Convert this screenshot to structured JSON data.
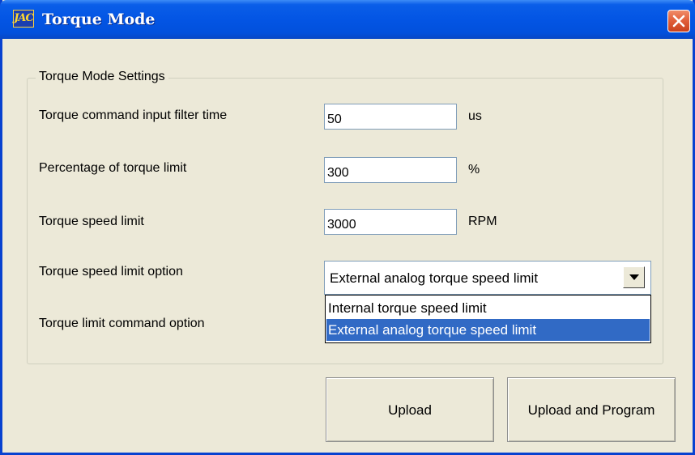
{
  "window": {
    "title": "Torque Mode",
    "icon_text": "JAC",
    "accent_color": "#0355e4",
    "close_color": "#e2613c"
  },
  "group": {
    "legend": "Torque Mode Settings"
  },
  "fields": {
    "filter_time": {
      "label": "Torque command input filter time",
      "value": "50",
      "unit": "us"
    },
    "torque_limit_pct": {
      "label": "Percentage of torque limit",
      "value": "300",
      "unit": "%"
    },
    "speed_limit": {
      "label": "Torque speed limit",
      "value": "3000",
      "unit": "RPM"
    },
    "speed_limit_option": {
      "label": "Torque speed limit option",
      "selected": "External analog torque speed limit",
      "options": [
        "Internal torque speed limit",
        "External analog torque speed limit"
      ],
      "highlighted_index": 1,
      "highlight_color": "#316ac5"
    },
    "limit_command_option": {
      "label": "Torque limit command option"
    }
  },
  "buttons": {
    "upload": "Upload",
    "upload_program": "Upload and Program"
  }
}
